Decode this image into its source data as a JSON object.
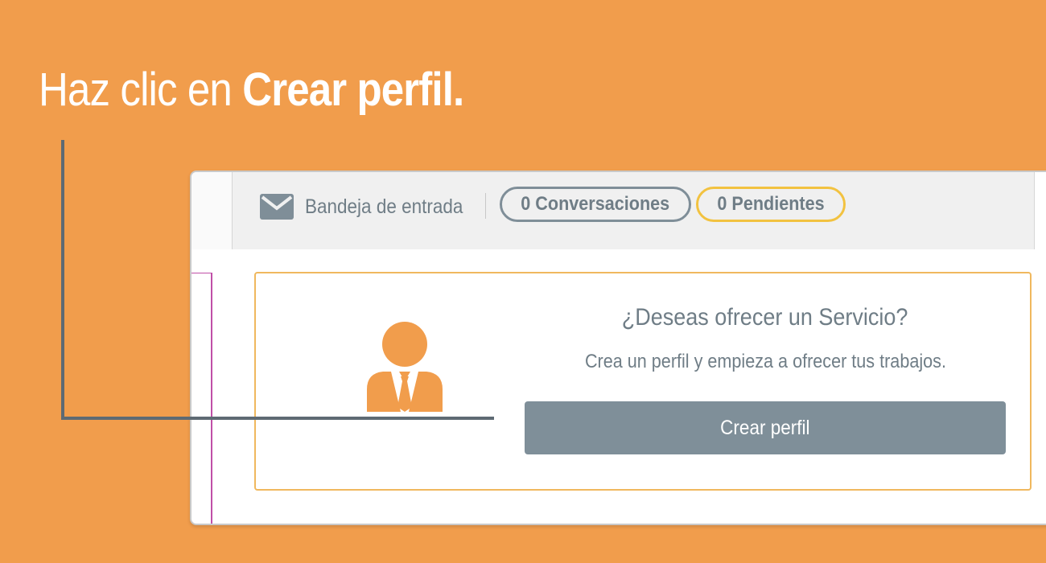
{
  "instruction": {
    "prefix": "Haz clic en ",
    "emphasis": "Crear perfil."
  },
  "header": {
    "inbox_icon": "envelope-icon",
    "inbox_label": "Bandeja de entrada",
    "conversations": "0 Conversaciones",
    "pending": "0 Pendientes"
  },
  "card": {
    "icon": "businessman-avatar-icon",
    "title": "¿Deseas ofrecer un Servicio?",
    "subtitle": "Crea un perfil y empieza a ofrecer tus trabajos.",
    "button_label": "Crear perfil"
  },
  "colors": {
    "background": "#f19d4c",
    "button": "#7f8f99",
    "pending_border": "#f2c240",
    "card_border": "#f0b85e",
    "avatar": "#f19d4c"
  }
}
